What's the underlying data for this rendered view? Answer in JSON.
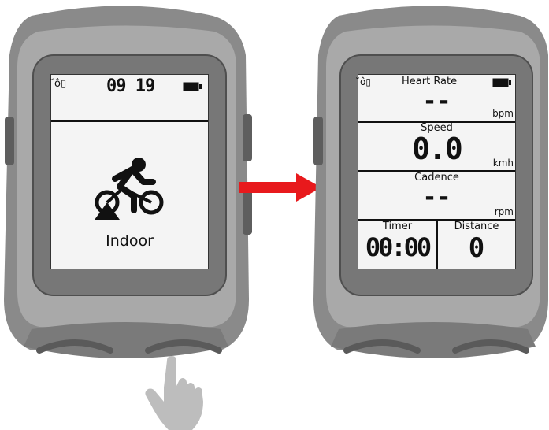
{
  "left_device": {
    "status": {
      "signal_text": "̆ô▯",
      "time": "09 19"
    },
    "mode": {
      "icon": "indoor-cycling-icon",
      "label": "Indoor"
    }
  },
  "right_device": {
    "status": {
      "signal_text": "̆ô▯",
      "title": "Heart Rate"
    },
    "fields": {
      "heart_rate": {
        "value": "--",
        "unit": "bpm"
      },
      "speed": {
        "label": "Speed",
        "value": "0.0",
        "unit": "kmh"
      },
      "cadence": {
        "label": "Cadence",
        "value": "--",
        "unit": "rpm"
      },
      "timer": {
        "label": "Timer",
        "value": "00:00"
      },
      "distance": {
        "label": "Distance",
        "value": "0"
      }
    }
  },
  "colors": {
    "shell": "#8a8a8a",
    "shell_light": "#a9a9a9",
    "bezel": "#6f6f6f",
    "screen": "#f4f4f4",
    "arrow": "#e8191c",
    "hand": "#bdbdbd"
  },
  "icons": {
    "battery": "battery-icon",
    "arrow": "right-arrow-icon",
    "hand": "pointing-hand-icon"
  }
}
